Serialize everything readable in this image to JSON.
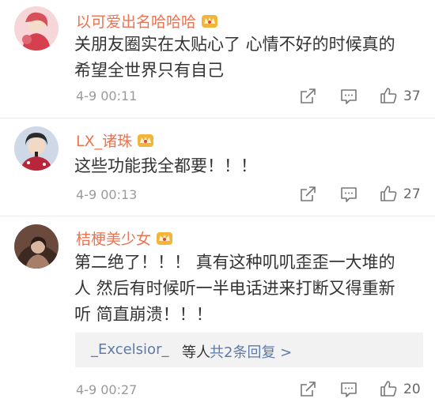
{
  "comments": [
    {
      "username": "以可爱出名哈哈哈",
      "lines": [
        "关朋友圈实在太贴心了 心情不好的时候真的",
        "希望全世界只有自己"
      ],
      "time": "4-9 00:11",
      "likes": "37"
    },
    {
      "username": "LX_诸珠",
      "lines": [
        "这些功能我全都要！！！"
      ],
      "time": "4-9 00:13",
      "likes": "27"
    },
    {
      "username": "桔梗美少女",
      "lines": [
        "第二绝了！！！ 真有这种叽叽歪歪一大堆的",
        "人 然后有时候听一半电话进来打断又得重新",
        "听 简直崩溃！！！"
      ],
      "time": "4-9 00:27",
      "likes": "20",
      "reply": {
        "user": "_Excelsior_",
        "etc": "等人",
        "more": "共2条回复 >"
      }
    }
  ],
  "icons": {
    "share": "share-icon",
    "comment": "comment-icon",
    "like": "thumbs-up-icon",
    "vip": "vip-crown-badge-icon"
  },
  "colors": {
    "username": "#eb7350",
    "link": "#5d7ba8",
    "meta": "#9a9a9a"
  }
}
